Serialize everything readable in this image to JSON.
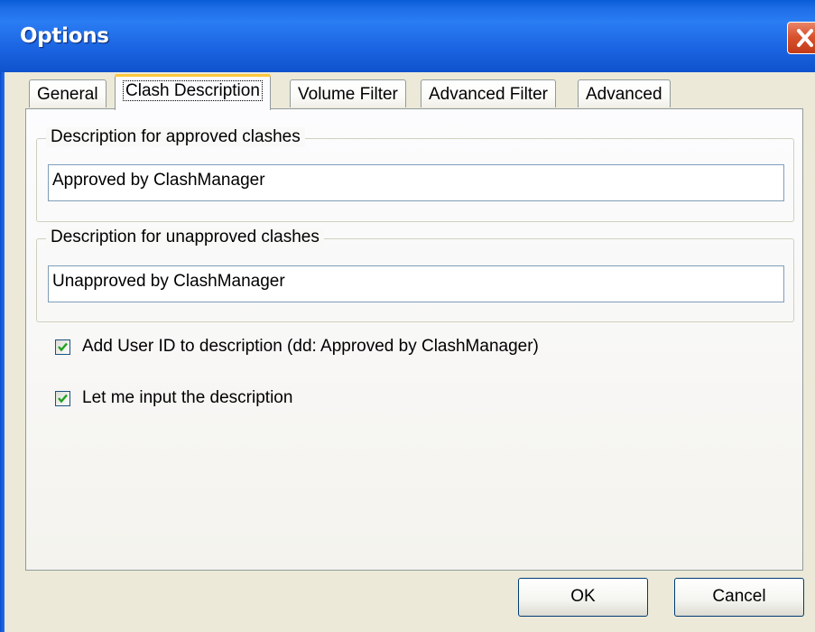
{
  "window": {
    "title": "Options"
  },
  "tabs": [
    {
      "label": "General",
      "active": false
    },
    {
      "label": "Clash Description",
      "active": true
    },
    {
      "label": "Volume Filter",
      "active": false
    },
    {
      "label": "Advanced Filter",
      "active": false
    },
    {
      "label": "Advanced",
      "active": false
    }
  ],
  "approved_group": {
    "label": "Description for approved clashes",
    "value": "Approved by ClashManager"
  },
  "unapproved_group": {
    "label": "Description for unapproved clashes",
    "value": "Unapproved by ClashManager"
  },
  "checkboxes": [
    {
      "label": "Add User ID to description (dd: Approved by ClashManager)",
      "checked": true
    },
    {
      "label": "Let me input the description",
      "checked": true
    }
  ],
  "buttons": {
    "ok_label": "OK",
    "cancel_label": "Cancel"
  },
  "colors": {
    "titlebar": "#1e6ee8",
    "close": "#d9532f",
    "face": "#ece9d8",
    "active_tab_highlight": "#ffc83c"
  }
}
